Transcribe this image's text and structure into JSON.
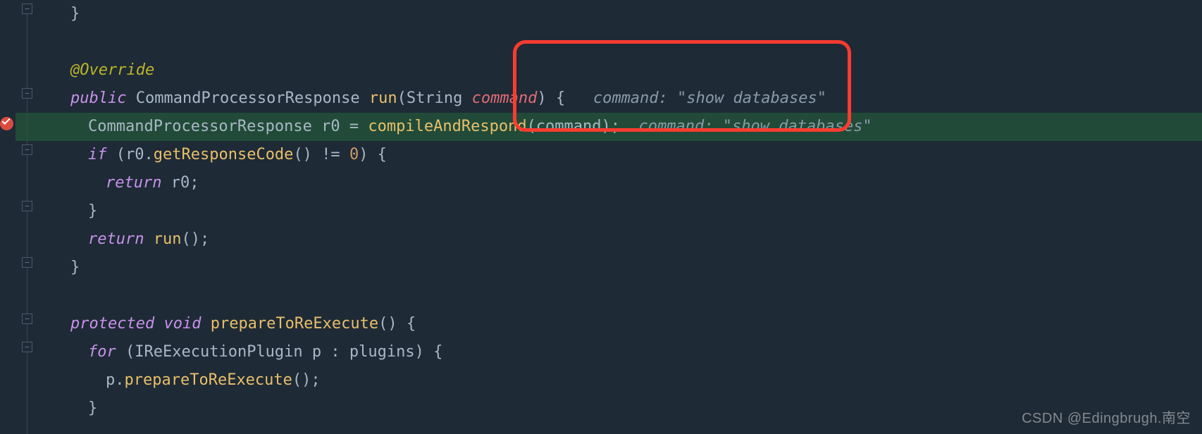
{
  "watermark": "CSDN @Edingbrugh.南空",
  "hints": {
    "run_param": "command: \"show databases\"",
    "compile_param": "command: \"show databases\""
  },
  "code": {
    "l1_brace": "}",
    "l2_ann": "@Override",
    "l3_kw": "public",
    "l3_type": "CommandProcessorResponse",
    "l3_method": "run",
    "l3_paramtype": "String",
    "l3_param": "command",
    "l4_type": "CommandProcessorResponse",
    "l4_var": "r0",
    "l4_call": "compileAndRespond",
    "l4_arg": "command",
    "l5_kw": "if",
    "l5_var": "r0",
    "l5_call": "getResponseCode",
    "l5_num": "0",
    "l6_kw": "return",
    "l6_var": "r0",
    "l7_brace": "}",
    "l8_kw": "return",
    "l8_call": "run",
    "l9_brace": "}",
    "l10_vis": "protected",
    "l10_rtype": "void",
    "l10_method": "prepareToReExecute",
    "l11_kw": "for",
    "l11_type": "IReExecutionPlugin",
    "l11_var": "p",
    "l11_coll": "plugins",
    "l12_var": "p",
    "l12_call": "prepareToReExecute",
    "l13_brace": "}"
  }
}
